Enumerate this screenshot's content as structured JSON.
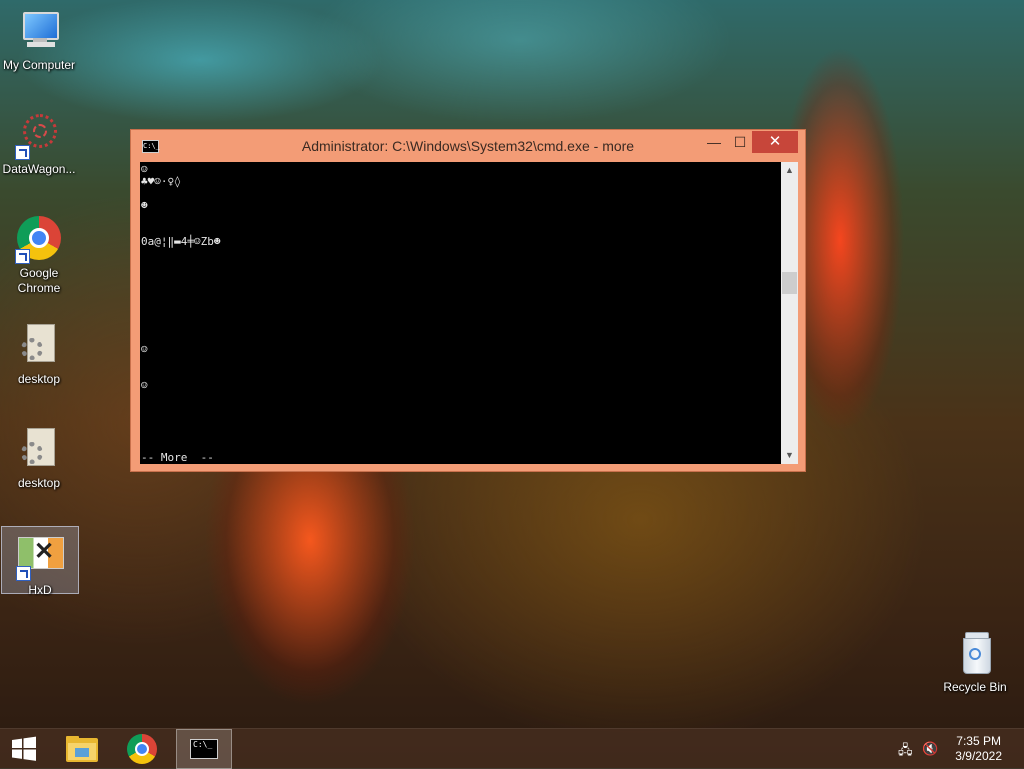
{
  "desktop": {
    "icons": [
      {
        "label": "My Computer"
      },
      {
        "label": "DataWagon..."
      },
      {
        "label": "Google Chrome"
      },
      {
        "label": "desktop"
      },
      {
        "label": "desktop"
      },
      {
        "label": "HxD"
      }
    ],
    "recycle_bin": {
      "label": "Recycle Bin"
    }
  },
  "cmd_window": {
    "title": "Administrator: C:\\Windows\\System32\\cmd.exe - more",
    "icon_text": "C:\\_",
    "close_symbol": "✕",
    "minimize_symbol": "—",
    "maximize_symbol": "☐",
    "console_lines": [
      "☺",
      "♣♥☺·♀◊",
      "☻",
      "0a@¦‖▬4╪☺Zb☻",
      "☺",
      "☺",
      "-- More  --"
    ]
  },
  "taskbar": {
    "time": "7:35 PM",
    "date": "3/9/2022",
    "items": [
      {
        "name": "start"
      },
      {
        "name": "file-explorer"
      },
      {
        "name": "chrome"
      },
      {
        "name": "cmd"
      }
    ]
  },
  "colors": {
    "window_frame": "#f39c76",
    "close_button": "#c7463a",
    "console_bg": "#000000"
  }
}
